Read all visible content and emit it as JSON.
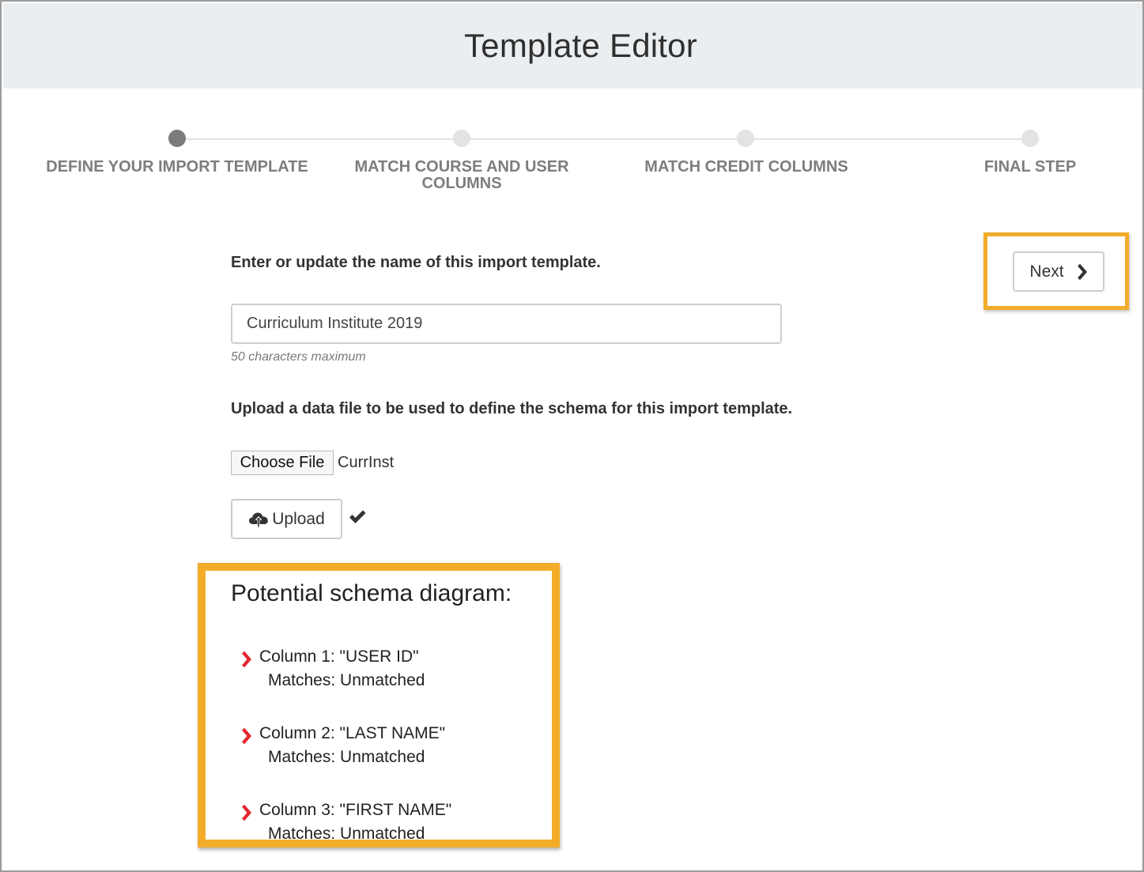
{
  "header": {
    "title": "Template Editor"
  },
  "stepper": {
    "steps": [
      {
        "label": "DEFINE YOUR IMPORT TEMPLATE",
        "active": true
      },
      {
        "label": "MATCH COURSE AND USER COLUMNS",
        "active": false
      },
      {
        "label": "MATCH CREDIT COLUMNS",
        "active": false
      },
      {
        "label": "FINAL STEP",
        "active": false
      }
    ]
  },
  "form": {
    "name_prompt": "Enter or update the name of this import template.",
    "name_value": "Curriculum Institute 2019",
    "name_hint": "50 characters maximum",
    "upload_prompt": "Upload a data file to be used to define the schema for this import template.",
    "choose_file_label": "Choose File",
    "chosen_file_name": "CurrInst",
    "upload_label": "Upload"
  },
  "nav": {
    "next_label": "Next"
  },
  "schema": {
    "title": "Potential schema diagram:",
    "columns": [
      {
        "label": "Column 1: \"USER ID\"",
        "matches": "Matches: Unmatched"
      },
      {
        "label": "Column 2: \"LAST NAME\"",
        "matches": "Matches: Unmatched"
      },
      {
        "label": "Column 3: \"FIRST NAME\"",
        "matches": "Matches: Unmatched"
      }
    ]
  },
  "colors": {
    "highlight": "#f2ac2a",
    "chevron_accent": "#e3262d",
    "header_bg": "#ebeef1",
    "active_step": "#7b7b7b",
    "inactive_step": "#e3e3e3"
  },
  "icons": {
    "upload": "cloud-upload-icon",
    "checkmark": "checkmark-icon",
    "next": "chevron-right-icon",
    "column_marker": "chevron-right-icon"
  }
}
